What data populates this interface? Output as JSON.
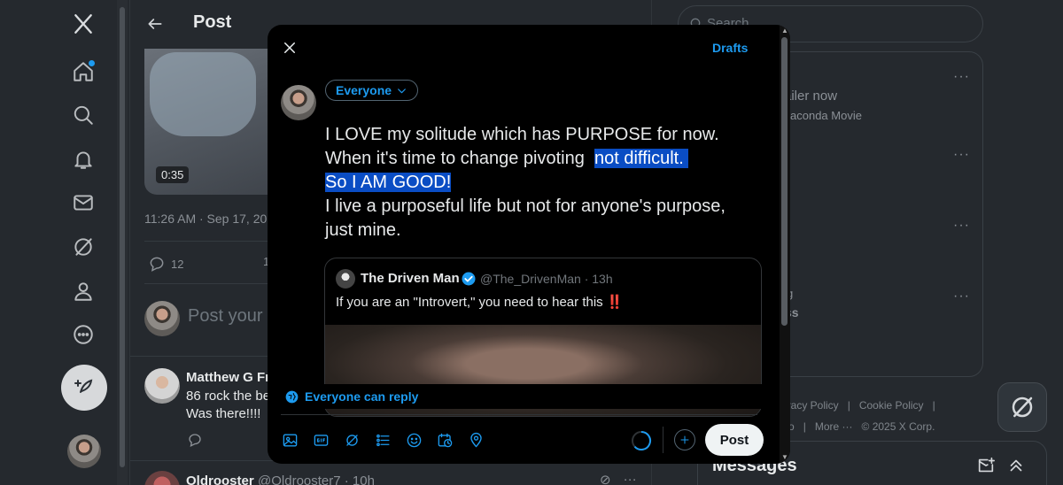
{
  "nav": {
    "items": [
      {
        "name": "x-logo",
        "label": "X"
      },
      {
        "name": "home",
        "label": "Home"
      },
      {
        "name": "explore",
        "label": "Explore"
      },
      {
        "name": "notifications",
        "label": "Notifications"
      },
      {
        "name": "messages",
        "label": "Messages"
      },
      {
        "name": "grok",
        "label": "Grok"
      },
      {
        "name": "profile",
        "label": "Profile"
      },
      {
        "name": "more",
        "label": "More"
      }
    ]
  },
  "main": {
    "header_title": "Post",
    "video_duration": "0:35",
    "post_time": "11:26 AM · Sep 17, 20",
    "reply_count": "12",
    "retweet_partial": "1",
    "reply_placeholder": "Post your",
    "comments": [
      {
        "name": "Matthew G Fr",
        "lines": [
          "86 rock the be",
          "Was there!!!!"
        ]
      },
      {
        "name": "Oldrooster",
        "handle": "@Oldrooster7 · 10h"
      }
    ]
  },
  "right": {
    "search_placeholder": "Search",
    "trend_line1": "railer now",
    "trend_line2": "aconda Movie",
    "trend_g": "g",
    "trend_ss": "ss",
    "footer_row1": [
      "rivacy Policy",
      "|",
      "Cookie Policy",
      "|"
    ],
    "footer_row2": [
      "nfo",
      "|",
      "More ···",
      "© 2025 X Corp."
    ],
    "messages_label": "Messages",
    "more_dots": "···"
  },
  "modal": {
    "drafts_label": "Drafts",
    "audience_label": "Everyone",
    "compose_lines": [
      {
        "text": "I LOVE my solitude which has PURPOSE for now."
      },
      {
        "plain": "When it's time to change pivoting  ",
        "highlight": "not difficult. "
      },
      {
        "highlight": "So I AM GOOD!"
      },
      {
        "text": "I live a purposeful life but not for anyone's purpose,"
      },
      {
        "text": "just mine."
      }
    ],
    "quote": {
      "name": "The Driven Man",
      "handle": "@The_DrivenMan · 13h",
      "text": "If you are an \"Introvert,\" you need to hear this",
      "emoji": "‼️"
    },
    "reply_setting": "Everyone can reply",
    "toolbar_icons": [
      "image-icon",
      "gif-icon",
      "grok-icon",
      "poll-icon",
      "emoji-icon",
      "schedule-icon",
      "location-icon"
    ],
    "post_label": "Post"
  },
  "colors": {
    "accent": "#1d9bf0",
    "highlight": "#0a4dc4",
    "background": "#25292e",
    "modal_bg": "#000000"
  }
}
